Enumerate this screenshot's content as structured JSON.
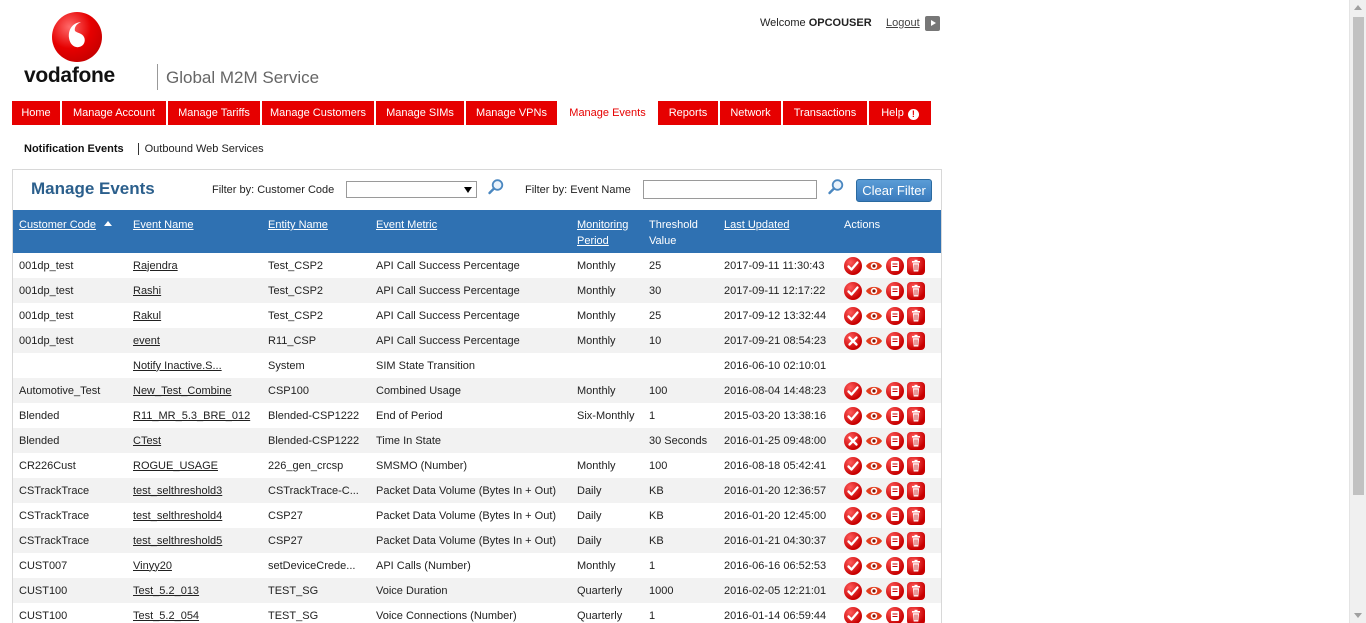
{
  "brand": {
    "logo_text": "vodafone",
    "product": "Global M2M Service",
    "accent": "#e60000",
    "logo_icon": "vodafone-speechmark-icon"
  },
  "user": {
    "welcome_prefix": "Welcome",
    "username": "OPCOUSER",
    "logout_label": "Logout"
  },
  "nav": {
    "items": [
      {
        "label": "Home",
        "w": 50
      },
      {
        "label": "Manage Account",
        "w": 106
      },
      {
        "label": "Manage Tariffs",
        "w": 94
      },
      {
        "label": "Manage Customers",
        "w": 114
      },
      {
        "label": "Manage SIMs",
        "w": 90
      },
      {
        "label": "Manage VPNs",
        "w": 93
      },
      {
        "label": "Manage Events",
        "w": 99
      },
      {
        "label": "Reports",
        "w": 62
      },
      {
        "label": "Network",
        "w": 63
      },
      {
        "label": "Transactions",
        "w": 86
      },
      {
        "label": "Help",
        "w": 64
      }
    ],
    "active": "Manage Events"
  },
  "subnav": {
    "active": "Notification Events",
    "link": "Outbound Web Services"
  },
  "panel": {
    "title": "Manage Events",
    "filter_customer_label": "Filter by: Customer Code",
    "filter_customer_value": "",
    "filter_event_label": "Filter by: Event Name",
    "filter_event_value": "",
    "clear_filter_label": "Clear Filter"
  },
  "table": {
    "columns": [
      {
        "label": "Customer Code",
        "sortable": true,
        "sorted": "asc"
      },
      {
        "label": "Event Name",
        "sortable": true
      },
      {
        "label": "Entity Name",
        "sortable": true
      },
      {
        "label": "Event Metric",
        "sortable": true
      },
      {
        "label": "Monitoring Period",
        "sortable": true
      },
      {
        "label": "Threshold Value",
        "sortable": false
      },
      {
        "label": "Last Updated",
        "sortable": true
      },
      {
        "label": "Actions",
        "sortable": false
      }
    ],
    "rows": [
      {
        "customer": "001dp_test",
        "event": "Rajendra",
        "entity": "Test_CSP2",
        "metric": "API Call Success Percentage",
        "period": "Monthly",
        "threshold": "25",
        "updated": "2017-09-11 11:30:43",
        "status": "active",
        "actions": true
      },
      {
        "customer": "001dp_test",
        "event": "Rashi",
        "entity": "Test_CSP2",
        "metric": "API Call Success Percentage",
        "period": "Monthly",
        "threshold": "30",
        "updated": "2017-09-11 12:17:22",
        "status": "active",
        "actions": true
      },
      {
        "customer": "001dp_test",
        "event": "Rakul",
        "entity": "Test_CSP2",
        "metric": "API Call Success Percentage",
        "period": "Monthly",
        "threshold": "25",
        "updated": "2017-09-12 13:32:44",
        "status": "active",
        "actions": true
      },
      {
        "customer": "001dp_test",
        "event": "event",
        "entity": "R11_CSP",
        "metric": "API Call Success Percentage",
        "period": "Monthly",
        "threshold": "10",
        "updated": "2017-09-21 08:54:23",
        "status": "inactive",
        "actions": true
      },
      {
        "customer": "",
        "event": "Notify Inactive.S...",
        "entity": "System",
        "metric": "SIM State Transition",
        "period": "",
        "threshold": "",
        "updated": "2016-06-10 02:10:01",
        "status": "",
        "actions": false
      },
      {
        "customer": "Automotive_Test",
        "event": "New_Test_Combine",
        "entity": "CSP100",
        "metric": "Combined Usage",
        "period": "Monthly",
        "threshold": "100",
        "updated": "2016-08-04 14:48:23",
        "status": "active",
        "actions": true
      },
      {
        "customer": "Blended",
        "event": "R11_MR_5.3_BRE_012",
        "entity": "Blended-CSP1222",
        "metric": "End of Period",
        "period": "Six-Monthly",
        "threshold": "1",
        "updated": "2015-03-20 13:38:16",
        "status": "active",
        "actions": true
      },
      {
        "customer": "Blended",
        "event": "CTest",
        "entity": "Blended-CSP1222",
        "metric": "Time In State",
        "period": "",
        "threshold": "30 Seconds",
        "updated": "2016-01-25 09:48:00",
        "status": "inactive",
        "actions": true
      },
      {
        "customer": "CR226Cust",
        "event": "ROGUE_USAGE",
        "entity": "226_gen_crcsp",
        "metric": "SMSMO (Number)",
        "period": "Monthly",
        "threshold": "100",
        "updated": "2016-08-18 05:42:41",
        "status": "active",
        "actions": true
      },
      {
        "customer": "CSTrackTrace",
        "event": "test_selthreshold3",
        "entity": "CSTrackTrace-C...",
        "metric": "Packet Data Volume (Bytes In + Out)",
        "period": "Daily",
        "threshold": " KB",
        "updated": "2016-01-20 12:36:57",
        "status": "active",
        "actions": true
      },
      {
        "customer": "CSTrackTrace",
        "event": "test_selthreshold4",
        "entity": "CSP27",
        "metric": "Packet Data Volume (Bytes In + Out)",
        "period": "Daily",
        "threshold": " KB",
        "updated": "2016-01-20 12:45:00",
        "status": "active",
        "actions": true
      },
      {
        "customer": "CSTrackTrace",
        "event": "test_selthreshold5",
        "entity": "CSP27",
        "metric": "Packet Data Volume (Bytes In + Out)",
        "period": "Daily",
        "threshold": " KB",
        "updated": "2016-01-21 04:30:37",
        "status": "active",
        "actions": true
      },
      {
        "customer": "CUST007",
        "event": "Vinyy20",
        "entity": "setDeviceCrede...",
        "metric": "API Calls (Number)",
        "period": "Monthly",
        "threshold": "1",
        "updated": "2016-06-16 06:52:53",
        "status": "active",
        "actions": true
      },
      {
        "customer": "CUST100",
        "event": "Test_5.2_013",
        "entity": "TEST_SG",
        "metric": "Voice Duration",
        "period": "Quarterly",
        "threshold": "1000",
        "updated": "2016-02-05 12:21:01",
        "status": "active",
        "actions": true
      },
      {
        "customer": "CUST100",
        "event": "Test_5.2_054",
        "entity": "TEST_SG",
        "metric": "Voice Connections (Number)",
        "period": "Quarterly",
        "threshold": "1",
        "updated": "2016-01-14 06:59:44",
        "status": "active",
        "actions": true
      }
    ]
  }
}
